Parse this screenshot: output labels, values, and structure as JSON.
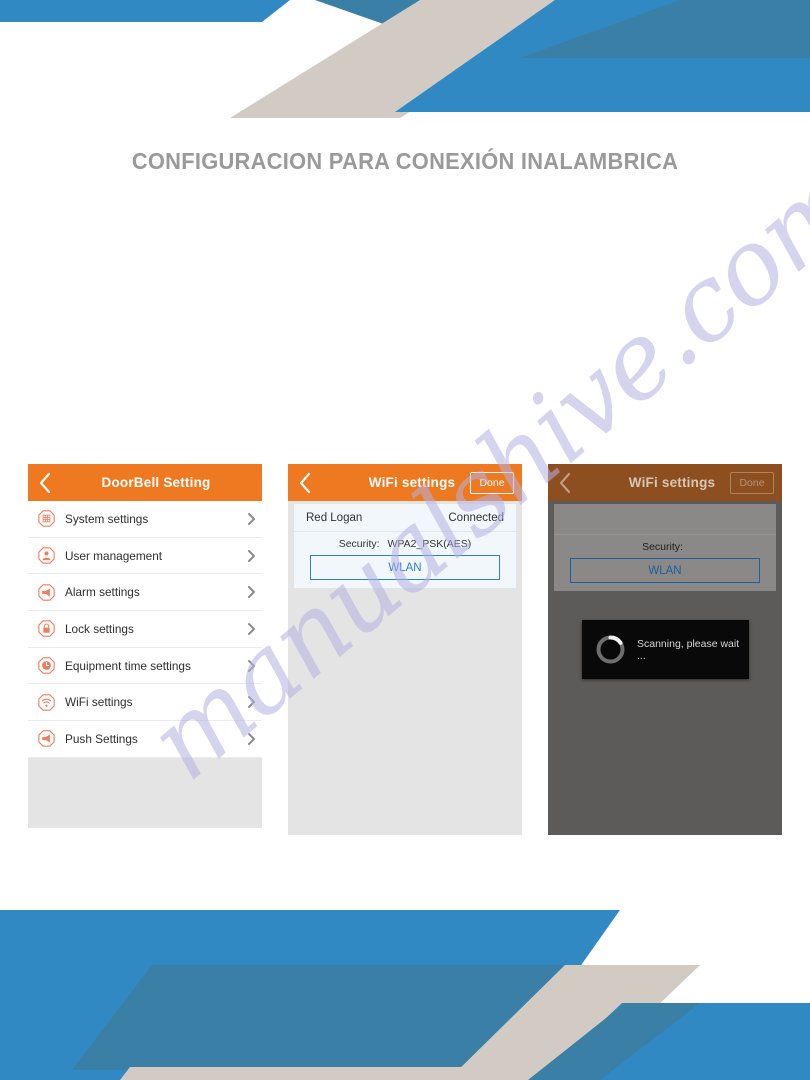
{
  "page": {
    "title": "CONFIGURACION PARA CONEXIÓN INALAMBRICA",
    "watermark": "manualshive.com"
  },
  "colors": {
    "accent_orange": "#ee7920",
    "accent_orange_dim": "#8e4f20",
    "banner_blue_light": "#3189c4",
    "banner_blue_dark": "#3a7fa5",
    "banner_beige": "#d2cbc3",
    "link_blue": "#2a7fd4",
    "title_gray": "#9a9a9a",
    "watermark_purple": "#b3b1e2"
  },
  "phone_doorbell": {
    "appbar": {
      "back_icon": "chevron-left-icon",
      "title": "DoorBell  Setting"
    },
    "items": [
      {
        "icon": "grid-icon",
        "label": "System settings"
      },
      {
        "icon": "user-icon",
        "label": "User management"
      },
      {
        "icon": "megaphone-icon",
        "label": "Alarm settings"
      },
      {
        "icon": "lock-icon",
        "label": "Lock settings"
      },
      {
        "icon": "clock-icon",
        "label": "Equipment time settings"
      },
      {
        "icon": "wifi-icon",
        "label": "WiFi settings"
      },
      {
        "icon": "megaphone-icon",
        "label": "Push Settings"
      }
    ],
    "chevron_icon": "chevron-right-icon"
  },
  "phone_wifi": {
    "appbar": {
      "back_icon": "chevron-left-icon",
      "title": "WiFi settings",
      "done_label": "Done"
    },
    "network": {
      "ssid": "Red Logan",
      "status": "Connected",
      "security_label": "Security:",
      "security_value": "WPA2_PSK(AES)",
      "wlan_button": "WLAN"
    }
  },
  "phone_scanning": {
    "appbar": {
      "back_icon": "chevron-left-icon",
      "title": "WiFi settings",
      "done_label": "Done"
    },
    "network": {
      "security_label": "Security:",
      "security_value": "",
      "wlan_button": "WLAN"
    },
    "dialog": {
      "spinner_icon": "loading-spinner-icon",
      "message": "Scanning, please wait ..."
    }
  }
}
